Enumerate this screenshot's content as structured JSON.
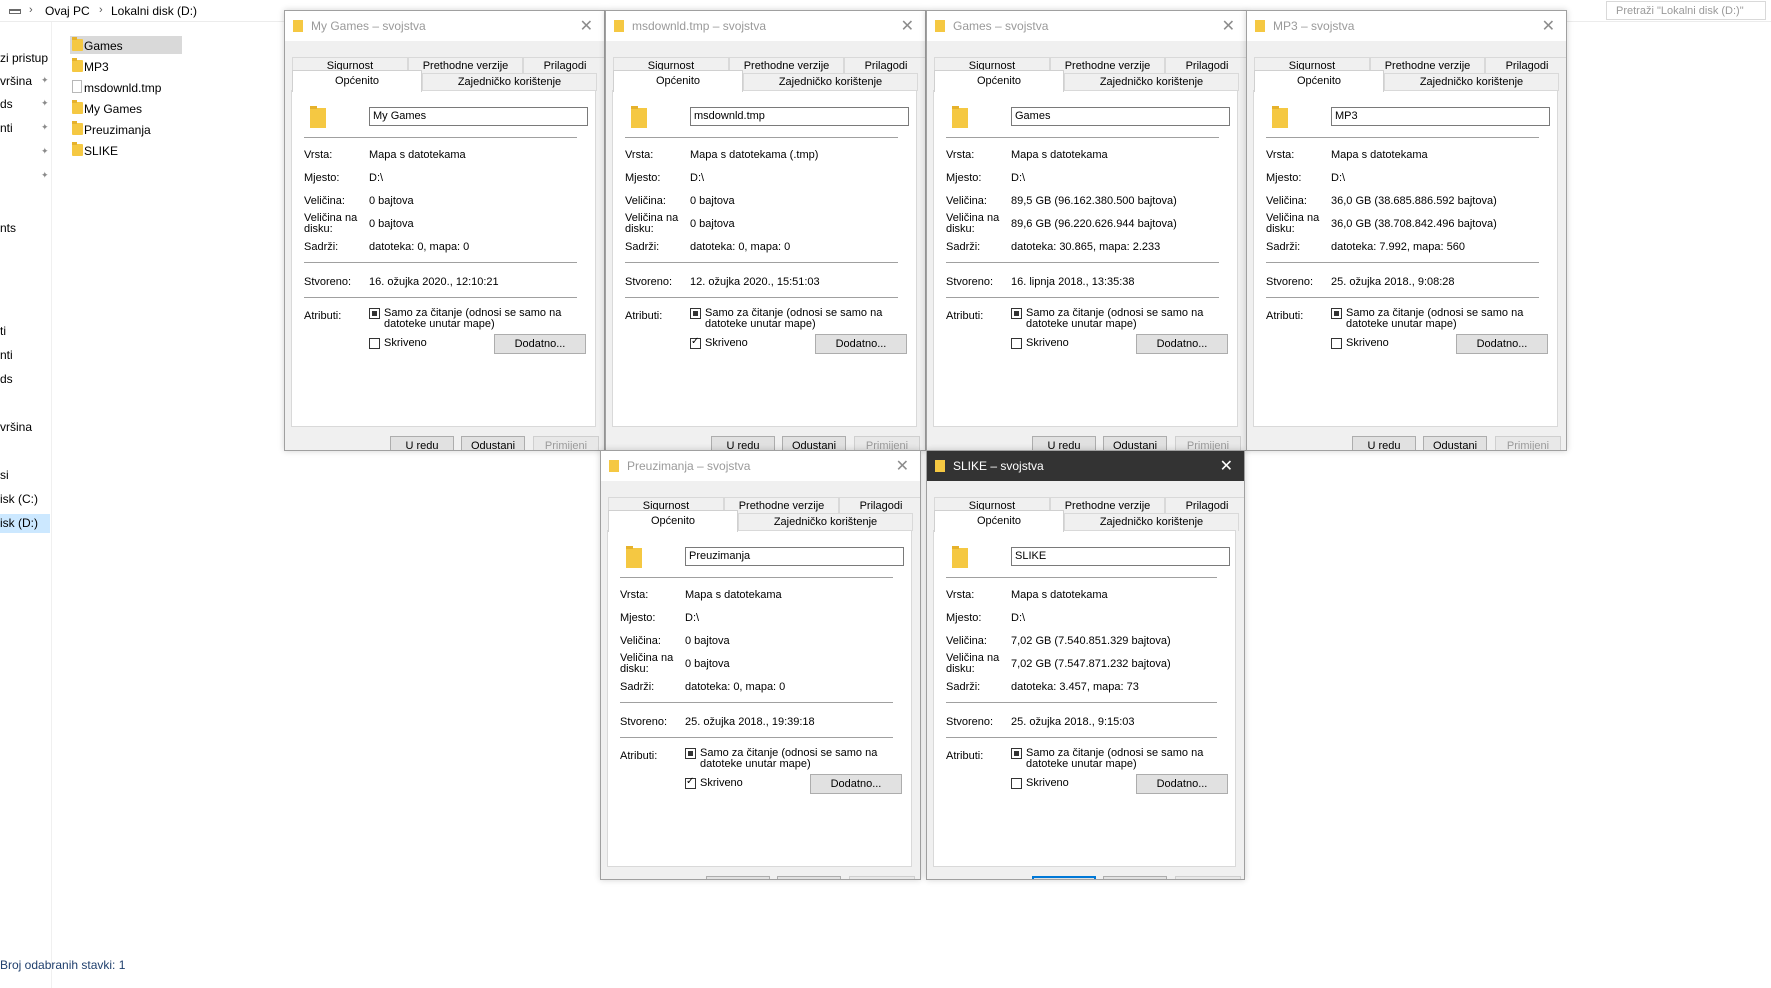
{
  "explorer": {
    "breadcrumb": [
      "Ovaj PC",
      "Lokalni disk (D:)"
    ],
    "search_placeholder": "Pretraži \"Lokalni disk (D:)\"",
    "nav_items": [
      {
        "label": "zi pristup",
        "pinned": false
      },
      {
        "label": "vršina",
        "pinned": true
      },
      {
        "label": "ds",
        "pinned": true
      },
      {
        "label": "nti",
        "pinned": true
      },
      {
        "label": "",
        "pinned": true
      },
      {
        "label": "",
        "pinned": true
      },
      {
        "label": "nts",
        "pinned": false
      },
      {
        "label": "ti",
        "pinned": false
      },
      {
        "label": "nti",
        "pinned": false
      },
      {
        "label": "ds",
        "pinned": false
      },
      {
        "label": "vršina",
        "pinned": false
      },
      {
        "label": "si",
        "pinned": false
      },
      {
        "label": "isk (C:)",
        "pinned": false
      },
      {
        "label": "isk (D:)",
        "pinned": false
      }
    ],
    "files": [
      {
        "name": "Games",
        "type": "folder"
      },
      {
        "name": "MP3",
        "type": "folder"
      },
      {
        "name": "msdownld.tmp",
        "type": "file"
      },
      {
        "name": "My Games",
        "type": "folder"
      },
      {
        "name": "Preuzimanja",
        "type": "folder"
      },
      {
        "name": "SLIKE",
        "type": "folder"
      }
    ],
    "status": "Broj odabranih stavki: 1"
  },
  "common": {
    "tabs_row1": [
      "Sigurnost",
      "Prethodne verzije",
      "Prilagodi"
    ],
    "tabs_row2": [
      "Općenito",
      "Zajedničko korištenje"
    ],
    "labels": {
      "vrsta": "Vrsta:",
      "mjesto": "Mjesto:",
      "velicina": "Veličina:",
      "velicina_na_disku": "Veličina na disku:",
      "sadrzi": "Sadrži:",
      "stvoreno": "Stvoreno:",
      "atributi": "Atributi:"
    },
    "readonly_label": "Samo za čitanje (odnosi se samo na datoteke unutar mape)",
    "hidden_label": "Skriveno",
    "advanced_button": "Dodatno...",
    "ok_button": "U redu",
    "cancel_button": "Odustani",
    "apply_button": "Primijeni"
  },
  "dialogs": [
    {
      "title": "My Games – svojstva",
      "name": "My Games",
      "vrsta": "Mapa s datotekama",
      "mjesto": "D:\\",
      "velicina": "0 bajtova",
      "velicina_na_disku": "0 bajtova",
      "sadrzi": "datoteka: 0, mapa: 0",
      "stvoreno": "16. ožujka 2020., 12:10:21",
      "hidden": false,
      "active": false
    },
    {
      "title": "msdownld.tmp – svojstva",
      "name": "msdownld.tmp",
      "vrsta": "Mapa s datotekama (.tmp)",
      "mjesto": "D:\\",
      "velicina": "0 bajtova",
      "velicina_na_disku": "0 bajtova",
      "sadrzi": "datoteka: 0, mapa: 0",
      "stvoreno": "12. ožujka 2020., 15:51:03",
      "hidden": true,
      "active": false
    },
    {
      "title": "Games – svojstva",
      "name": "Games",
      "vrsta": "Mapa s datotekama",
      "mjesto": "D:\\",
      "velicina": "89,5 GB (96.162.380.500 bajtova)",
      "velicina_na_disku": "89,6 GB (96.220.626.944 bajtova)",
      "sadrzi": "datoteka: 30.865, mapa: 2.233",
      "stvoreno": "16. lipnja 2018., 13:35:38",
      "hidden": false,
      "active": false
    },
    {
      "title": "MP3 – svojstva",
      "name": "MP3",
      "vrsta": "Mapa s datotekama",
      "mjesto": "D:\\",
      "velicina": "36,0 GB (38.685.886.592 bajtova)",
      "velicina_na_disku": "36,0 GB (38.708.842.496 bajtova)",
      "sadrzi": "datoteka: 7.992, mapa: 560",
      "stvoreno": "25. ožujka 2018., 9:08:28",
      "hidden": false,
      "active": false
    },
    {
      "title": "Preuzimanja – svojstva",
      "name": "Preuzimanja",
      "vrsta": "Mapa s datotekama",
      "mjesto": "D:\\",
      "velicina": "0 bajtova",
      "velicina_na_disku": "0 bajtova",
      "sadrzi": "datoteka: 0, mapa: 0",
      "stvoreno": "25. ožujka 2018., 19:39:18",
      "hidden": true,
      "active": false
    },
    {
      "title": "SLIKE – svojstva",
      "name": "SLIKE",
      "vrsta": "Mapa s datotekama",
      "mjesto": "D:\\",
      "velicina": "7,02 GB (7.540.851.329 bajtova)",
      "velicina_na_disku": "7,02 GB (7.547.871.232 bajtova)",
      "sadrzi": "datoteka: 3.457, mapa: 73",
      "stvoreno": "25. ožujka 2018., 9:15:03",
      "hidden": false,
      "active": true
    }
  ]
}
